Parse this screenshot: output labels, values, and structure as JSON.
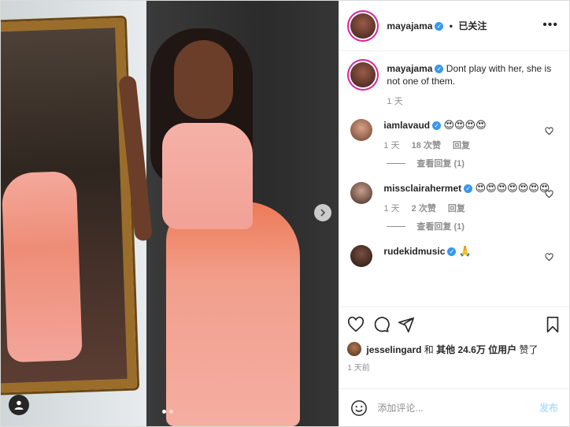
{
  "header": {
    "username": "mayajama",
    "separator": "•",
    "follow_status": "已关注",
    "more": "•••"
  },
  "caption": {
    "username": "mayajama",
    "text": "Dont play with her, she is not one of them.",
    "time": "1 天"
  },
  "comments": [
    {
      "username": "iamlavaud",
      "text": "😍😍😍😍",
      "time": "1 天",
      "likes": "18 次赞",
      "reply": "回复",
      "view_replies": "查看回复 (1)"
    },
    {
      "username": "missclairahermet",
      "text": "😍😍😍😍😍😍😍",
      "time": "1 天",
      "likes": "2 次赞",
      "reply": "回复",
      "view_replies": "查看回复 (1)"
    },
    {
      "username": "rudekidmusic",
      "text": "🙏"
    }
  ],
  "likes": {
    "user": "jesselingard",
    "and": "和",
    "others": "其他 24.6万 位用户",
    "suffix": "赞了"
  },
  "post_time": "1 天前",
  "add_comment": {
    "placeholder": "添加评论...",
    "post_label": "发布"
  },
  "colors": {
    "accent": "#3897f0",
    "post_disabled": "#b2dffc",
    "muted": "#8e8e8e"
  }
}
